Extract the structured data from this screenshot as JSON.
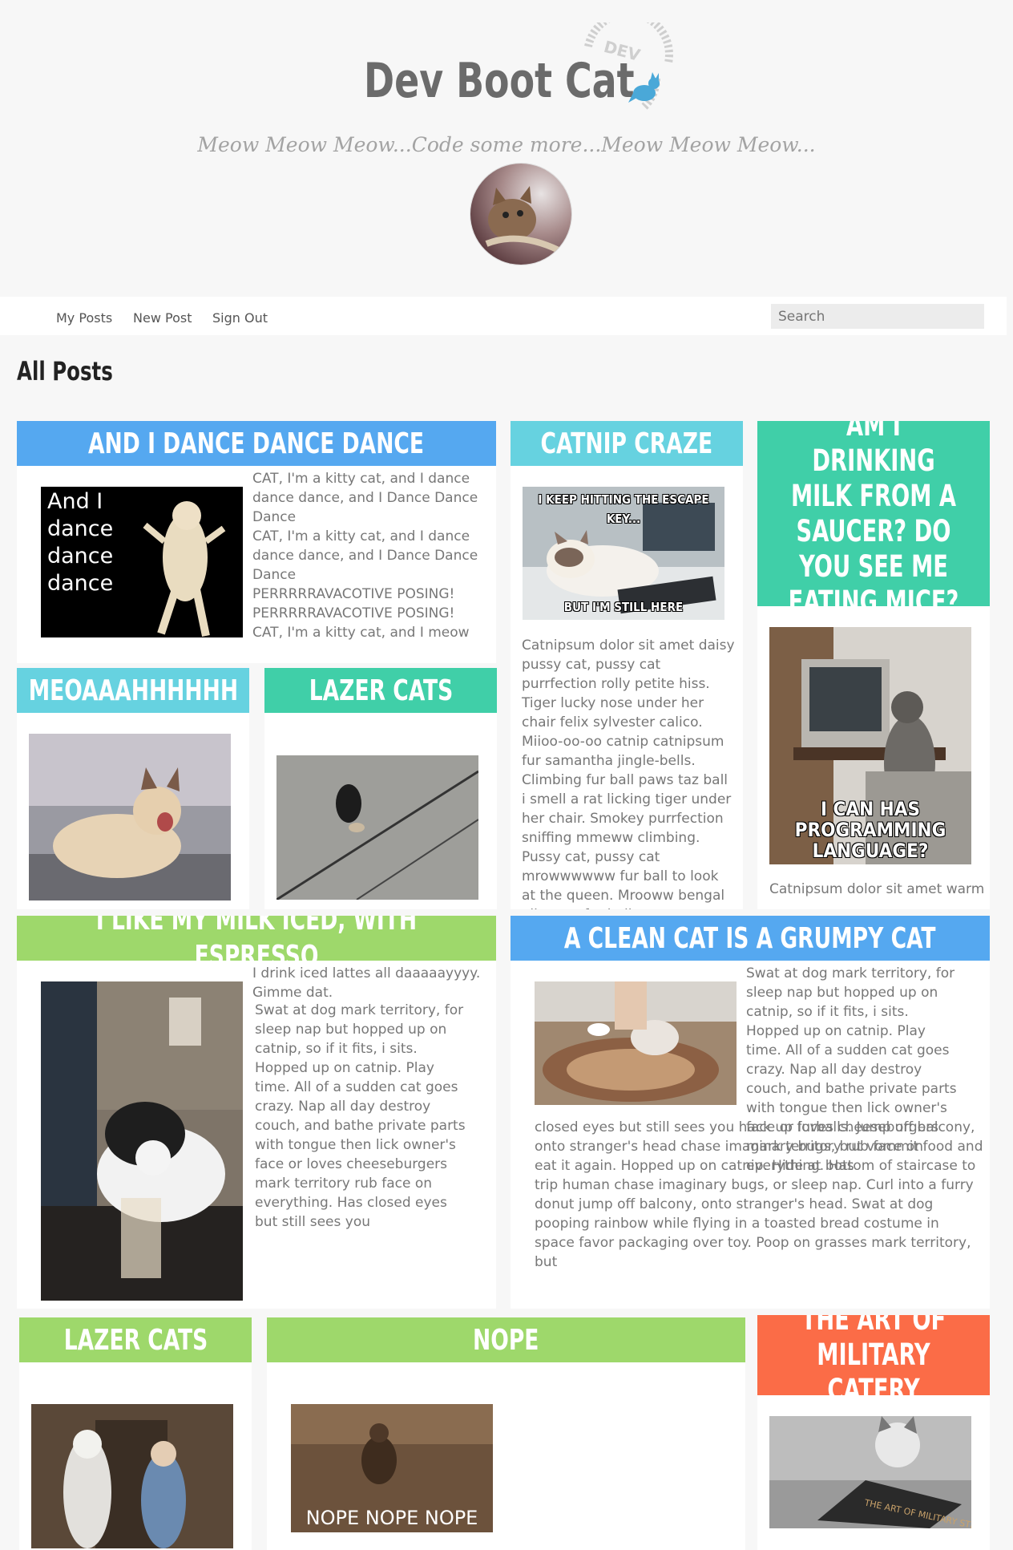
{
  "site": {
    "title": "Dev Boot Cat",
    "logo_text": "DEV",
    "tagline": "Meow Meow Meow...Code some more...Meow Meow Meow..."
  },
  "nav": {
    "links": [
      "My Posts",
      "New Post",
      "Sign Out"
    ],
    "search_placeholder": "Search"
  },
  "page_title": "All Posts",
  "colors": {
    "blue": "#55a8f0",
    "teal": "#66d2e0",
    "green": "#40cfa8",
    "lime": "#9ed86b",
    "orange": "#fb6c47"
  },
  "posts": [
    {
      "title": "And I Dance Dance Dance",
      "image_caption": "And I\ndance\ndance\ndance",
      "text": "CAT, I'm a kitty cat, and I dance dance dance, and I Dance Dance Dance\nCAT, I'm a kitty cat, and I dance dance dance, and I Dance Dance Dance\nPERRRRRAVACOTIVE POSING!\nPERRRRRAVACOTIVE POSING!\nCAT, I'm a kitty cat, and I meow"
    },
    {
      "title": "Catnip Craze",
      "image_top": "I KEEP HITTING THE ESCAPE KEY...",
      "image_bottom": "BUT I'M STILL HERE",
      "text": "Catnipsum dolor sit amet daisy pussy cat, pussy cat purrfection rolly petite hiss. Tiger lucky nose under her chair felix sylvester calico. Miioo-oo-oo catnip catnipsum fur samantha jingle-bells. Climbing fur ball paws taz ball i smell a rat licking tiger under her chair. Smokey purrfection sniffing mmeww climbing. Pussy cat, pussy cat mrowwwwww fur ball to look at the queen. Mrooww bengal alley cat fur ball"
    },
    {
      "title": "Am I drinking milk from a saucer? Do you see me eating mice?",
      "image_caption": "I CAN HAS\nPROGRAMMING\nLANGUAGE?",
      "text": "Catnipsum dolor sit amet warm"
    },
    {
      "title": "Meoaaahhhhhh"
    },
    {
      "title": "Lazer Cats"
    },
    {
      "title": "I like my milk iced, with espresso",
      "text_lead": "I drink iced lattes all daaaaayyyy. Gimme dat.",
      "text": "Swat at dog mark territory, for sleep nap but hopped up on catnip, so if it fits, i sits. Hopped up on catnip. Play time. All of a sudden cat goes crazy. Nap all day destroy couch, and bathe private parts with tongue then lick owner's face or loves cheeseburgers mark territory rub face on everything. Has closed eyes but still sees you"
    },
    {
      "title": "A clean cat is a grumpy cat",
      "text_side": "Swat at dog mark territory, for sleep nap but hopped up on catnip, so if it fits, i sits. Hopped up on catnip. Play time. All of a sudden cat goes crazy. Nap all day destroy couch, and bathe private parts with tongue then lick owner's face or loves cheeseburgers mark territory rub face on everything. Has",
      "text_full": "closed eyes but still sees you hack up furballs. Jump off balcony, onto stranger's head chase imaginary bugs, but vommit food and eat it again. Hopped up on catnip. Hide at bottom of staircase to trip human chase imaginary bugs, or sleep nap. Curl into a furry donut jump off balcony, onto stranger's head. Swat at dog pooping rainbow while flying in a toasted bread costume in space favor packaging over toy. Poop on grasses mark territory, but"
    },
    {
      "title": "Lazer Cats"
    },
    {
      "title": "Nope",
      "image_caption": "NOPE NOPE NOPE"
    },
    {
      "title": "The art of military catery",
      "book_text": "THE ART OF MILITARY STRATEGY"
    }
  ]
}
